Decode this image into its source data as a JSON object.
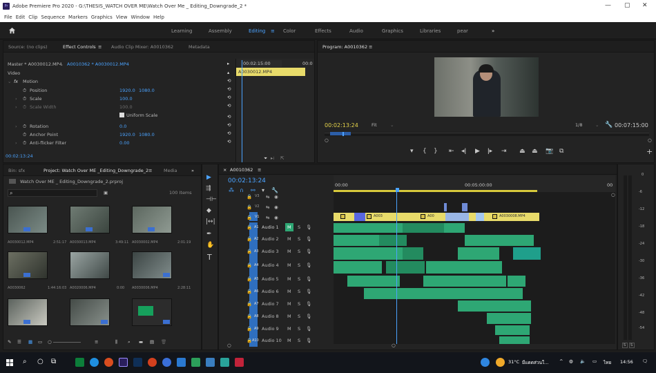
{
  "window": {
    "app_icon": "Pr",
    "title": "Adobe Premiere Pro 2020 - G:\\THESIS_WATCH OVER ME\\Watch Over Me _ Editing_Downgrade_2 *",
    "minimize": "—",
    "maximize": "▢",
    "close": "✕"
  },
  "menu": [
    "File",
    "Edit",
    "Clip",
    "Sequence",
    "Markers",
    "Graphics",
    "View",
    "Window",
    "Help"
  ],
  "workspaces": {
    "home_icon": "home-icon",
    "items": [
      "Learning",
      "Assembly",
      "Editing",
      "Color",
      "Effects",
      "Audio",
      "Graphics",
      "Libraries",
      "pear"
    ],
    "active_menu": "≡",
    "more": "»"
  },
  "source_panel": {
    "tabs": [
      "Source: (no clips)",
      "Effect Controls",
      "Audio Clip Mixer: A0010362",
      "Metadata"
    ],
    "tab_menu": "≡",
    "clip_path": "Master * A0030012.MP4",
    "seq_path": "A0010362 * A0030012.MP4",
    "section_video": "Video",
    "fx_label": "fx",
    "motion": "Motion",
    "props": [
      {
        "name": "Position",
        "v1": "1920.0",
        "v2": "1080.0"
      },
      {
        "name": "Scale",
        "v1": "100.0",
        "v2": ""
      },
      {
        "name": "Scale Width",
        "v1": "100.0",
        "v2": ""
      },
      {
        "name": "Uniform Scale",
        "v1": "",
        "v2": ""
      },
      {
        "name": "Rotation",
        "v1": "0.0",
        "v2": ""
      },
      {
        "name": "Anchor Point",
        "v1": "1920.0",
        "v2": "1080.0"
      },
      {
        "name": "Anti-flicker Filter",
        "v1": "0.00",
        "v2": ""
      }
    ],
    "mini_timecode": "00:02:15:00",
    "mini_timecode2": "00:0",
    "mini_clip": "A0030012.MP4",
    "bottom_timecode": "00:02:13:24"
  },
  "program_monitor": {
    "tab": "Program: A0010362",
    "tab_menu": "≡",
    "timecode": "00:02:13:24",
    "fit": "Fit",
    "ratio": "1/8",
    "duration": "00:07:15:00",
    "wrench_icon": "wrench-icon"
  },
  "project_panel": {
    "tabs": [
      "Bin: sfx",
      "Project: Watch Over ME _Editing_Downgrade_2",
      "Media"
    ],
    "tab_menu": "≡",
    "more": "»",
    "project_file": "Watch Over ME _ Editing_Downgrade_2.prproj",
    "search_icon": "search-icon",
    "items_count": "100 Items",
    "thumbs": [
      {
        "name": "A0030012.MP4",
        "dur": "2:51:17"
      },
      {
        "name": "A0030013.MP4",
        "dur": "3:49:11"
      },
      {
        "name": "A0030002.MP4",
        "dur": "2:01:19"
      },
      {
        "name": "A0030062",
        "dur": "1:44:16:03"
      },
      {
        "name": "A0020006.MP4",
        "dur": "0:00"
      },
      {
        "name": "A0030006.MP4",
        "dur": "2:28:11"
      },
      {
        "name": "",
        "dur": ""
      },
      {
        "name": "",
        "dur": ""
      },
      {
        "name": "",
        "dur": ""
      }
    ]
  },
  "timeline": {
    "tab": "A0010362",
    "tab_close": "×",
    "tab_menu": "≡",
    "timecode": "00:02:13:24",
    "ruler": [
      "00:00",
      "00:05:00:00",
      "00"
    ],
    "video_tracks": [
      "V3",
      "V2",
      "V1"
    ],
    "audio_tracks": [
      {
        "id": "A1",
        "name": "Audio 1"
      },
      {
        "id": "A2",
        "name": "Audio 2"
      },
      {
        "id": "A3",
        "name": "Audio 3"
      },
      {
        "id": "A4",
        "name": "Audio 4"
      },
      {
        "id": "A5",
        "name": "Audio 5"
      },
      {
        "id": "A6",
        "name": "Audio 6"
      },
      {
        "id": "A7",
        "name": "Audio 7"
      },
      {
        "id": "A8",
        "name": "Audio 8"
      },
      {
        "id": "A9",
        "name": "Audio 9"
      },
      {
        "id": "A10",
        "name": "Audio 10"
      }
    ],
    "mute": "M",
    "solo": "S",
    "v1_clips": [
      "A003",
      "A00",
      "A0030008.MP4"
    ]
  },
  "meter": {
    "scale": [
      "0",
      "-6",
      "-12",
      "-18",
      "-24",
      "-30",
      "-36",
      "-42",
      "-48",
      "-54"
    ],
    "solo_l": "S",
    "solo_r": "S"
  },
  "taskbar": {
    "weather": "31°C",
    "weather_text": "มีแดดส่วนใ...",
    "lang": "ไทย",
    "time": "14:56"
  },
  "colors": {
    "accent_blue": "#4ba3ff",
    "video_clip": "#e8db6a",
    "audio_clip": "#2ea774",
    "playhead": "#4ba3ff",
    "workarea": "#d7c93b"
  }
}
